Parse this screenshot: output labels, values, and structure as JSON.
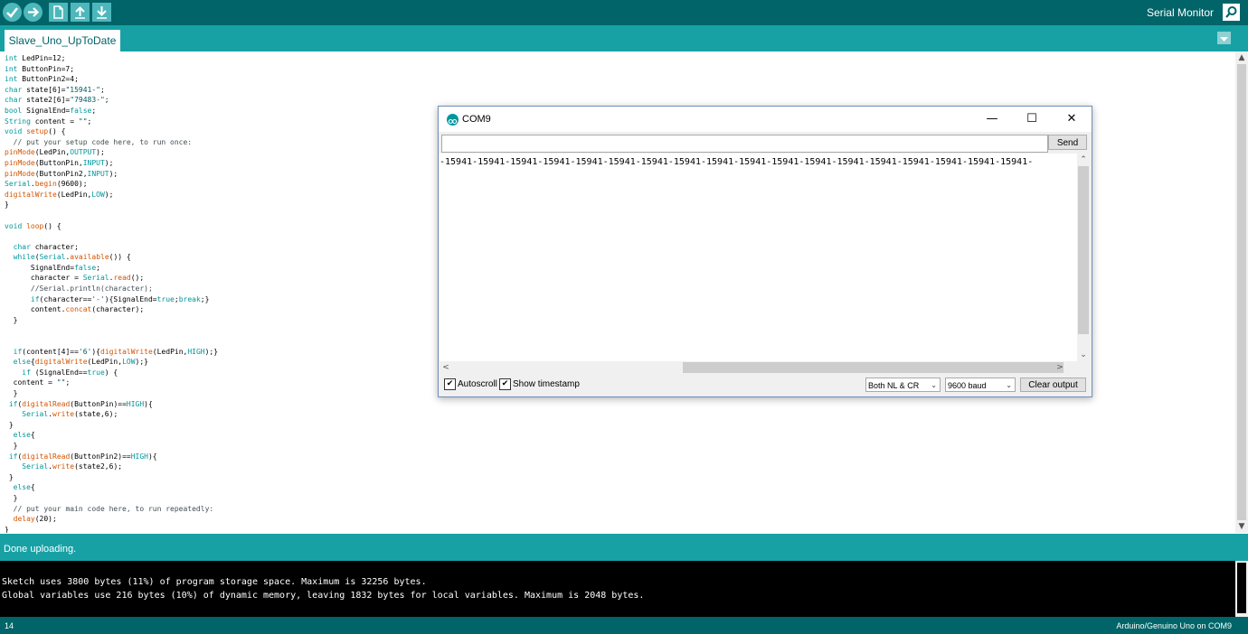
{
  "toolbar": {
    "buttons": [
      "verify-icon",
      "upload-icon",
      "new-icon",
      "open-icon",
      "save-icon"
    ],
    "serial_monitor_label": "Serial Monitor",
    "background": "#006468",
    "button_color": "#4db7bb"
  },
  "tabs": [
    {
      "label": "Slave_Uno_UpToDate"
    }
  ],
  "editor": {
    "lines": [
      "int LedPin=12;",
      "int ButtonPin=7;",
      "int ButtonPin2=4;",
      "char state[6]=\"15941-\";",
      "char state2[6]=\"79483-\";",
      "bool SignalEnd=false;",
      "String content = \"\";",
      "void setup() {",
      "  // put your setup code here, to run once:",
      "pinMode(LedPin,OUTPUT);",
      "pinMode(ButtonPin,INPUT);",
      "pinMode(ButtonPin2,INPUT);",
      "Serial.begin(9600);",
      "digitalWrite(LedPin,LOW);",
      "}",
      "",
      "void loop() {",
      "",
      "  char character;",
      "  while(Serial.available()) {",
      "      SignalEnd=false;",
      "      character = Serial.read();",
      "      //Serial.println(character);",
      "      if(character=='-'){SignalEnd=true;break;}",
      "      content.concat(character);",
      "  }",
      "",
      "",
      "  if(content[4]=='6'){digitalWrite(LedPin,HIGH);}",
      "  else{digitalWrite(LedPin,LOW);}",
      "    if (SignalEnd==true) {",
      "  content = \"\";",
      "  }",
      " if(digitalRead(ButtonPin)==HIGH){",
      "    Serial.write(state,6);",
      " }",
      "  else{",
      "  }",
      " if(digitalRead(ButtonPin2)==HIGH){",
      "    Serial.write(state2,6);",
      " }",
      "  else{",
      "  }",
      "  // put your main code here, to run repeatedly:",
      "  delay(20);",
      "}"
    ]
  },
  "status": {
    "message": "Done uploading."
  },
  "console": {
    "lines": [
      "Sketch uses 3800 bytes (11%) of program storage space. Maximum is 32256 bytes.",
      "Global variables use 216 bytes (10%) of dynamic memory, leaving 1832 bytes for local variables. Maximum is 2048 bytes."
    ]
  },
  "footer": {
    "line_number": "14",
    "board": "Arduino/Genuino Uno on COM9"
  },
  "serial_window": {
    "title": "COM9",
    "minimize": "—",
    "maximize": "☐",
    "close": "✕",
    "input_value": "",
    "send_label": "Send",
    "output_text": "-15941-15941-15941-15941-15941-15941-15941-15941-15941-15941-15941-15941-15941-15941-15941-15941-15941-15941-",
    "autoscroll_label": "Autoscroll",
    "autoscroll_checked": true,
    "timestamp_label": "Show timestamp",
    "timestamp_checked": true,
    "line_ending": "Both NL & CR",
    "baud_rate": "9600 baud",
    "clear_label": "Clear output",
    "check_mark": "✔"
  }
}
